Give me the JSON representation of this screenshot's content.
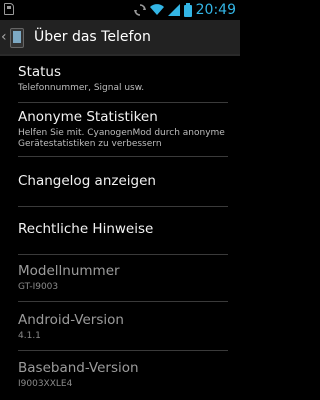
{
  "status_bar": {
    "time": "20:49",
    "left_icon": "sd-card-icon",
    "right_icons": [
      "sync-icon",
      "wifi-icon",
      "signal-icon",
      "battery-icon"
    ]
  },
  "action_bar": {
    "title": "Über das Telefon",
    "back_icon": "chevron-left-icon",
    "app_icon": "settings-phone-icon"
  },
  "items": [
    {
      "label": "Status",
      "sub": "Telefonnummer, Signal usw."
    },
    {
      "label": "Anonyme Statistiken",
      "sub": "Helfen Sie mit. CyanogenMod durch anonyme Gerätestatistiken zu verbessern"
    },
    {
      "label": "Changelog anzeigen",
      "sub": ""
    },
    {
      "label": "Rechtliche Hinweise",
      "sub": ""
    },
    {
      "label": "Modellnummer",
      "sub": "GT-I9003"
    },
    {
      "label": "Android-Version",
      "sub": "4.1.1"
    },
    {
      "label": "Baseband-Version",
      "sub": "I9003XXLE4"
    }
  ],
  "colors": {
    "accent": "#33b5e5",
    "background": "#000000",
    "action_bar": "#222222"
  }
}
